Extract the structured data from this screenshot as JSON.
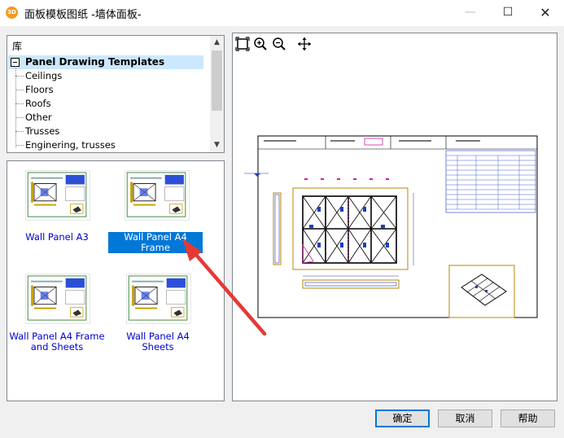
{
  "window": {
    "app_icon_text": "3D",
    "title": "面板模板图纸  -墙体面板-",
    "minimize": "—",
    "maximize": "☐",
    "close": "✕"
  },
  "tree": {
    "root_label": "库",
    "group_label": "Panel Drawing Templates",
    "children": [
      "Ceilings",
      "Floors",
      "Roofs",
      "Other",
      "Trusses",
      "Enginering, trusses"
    ]
  },
  "templates": [
    {
      "caption": "Wall Panel A3",
      "selected": false
    },
    {
      "caption": "Wall Panel A4 Frame",
      "selected": true
    },
    {
      "caption": "Wall Panel A4 Frame and Sheets",
      "selected": false
    },
    {
      "caption": "Wall Panel A4 Sheets",
      "selected": false
    }
  ],
  "preview_toolbar": [
    "zoom-extents-icon",
    "zoom-in-icon",
    "zoom-out-icon",
    "pan-icon"
  ],
  "buttons": {
    "ok": "确定",
    "cancel": "取消",
    "help": "帮助"
  },
  "colors": {
    "selection": "#0078d7",
    "caption_link": "#0000cc",
    "annotation_arrow": "#e53935",
    "drawing_frame": "#b8860b",
    "drawing_blue": "#1a3cc4"
  }
}
